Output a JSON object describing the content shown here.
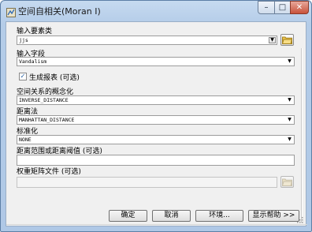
{
  "window": {
    "title": "空间自相关(Moran I)"
  },
  "fields": {
    "input_features": {
      "label": "输入要素类",
      "value": "jjs"
    },
    "input_field": {
      "label": "输入字段",
      "value": "Vandalism"
    },
    "generate_report": {
      "label": "生成报表 (可选)",
      "checked": true,
      "check_glyph": "✓"
    },
    "conceptualization": {
      "label": "空间关系的概念化",
      "value": "INVERSE_DISTANCE"
    },
    "distance_method": {
      "label": "距离法",
      "value": "MANHATTAN_DISTANCE"
    },
    "standardization": {
      "label": "标准化",
      "value": "NONE"
    },
    "distance_threshold": {
      "label": "距离范围或距离阈值 (可选)",
      "value": ""
    },
    "weights_matrix": {
      "label": "权重矩阵文件 (可选)",
      "value": ""
    }
  },
  "buttons": {
    "ok": "确定",
    "cancel": "取消",
    "environments": "环境...",
    "show_help": "显示帮助 >>"
  },
  "icons": {
    "dropdown_arrow": "▼",
    "minimize": "–",
    "maximize": "□",
    "close": "✕"
  }
}
